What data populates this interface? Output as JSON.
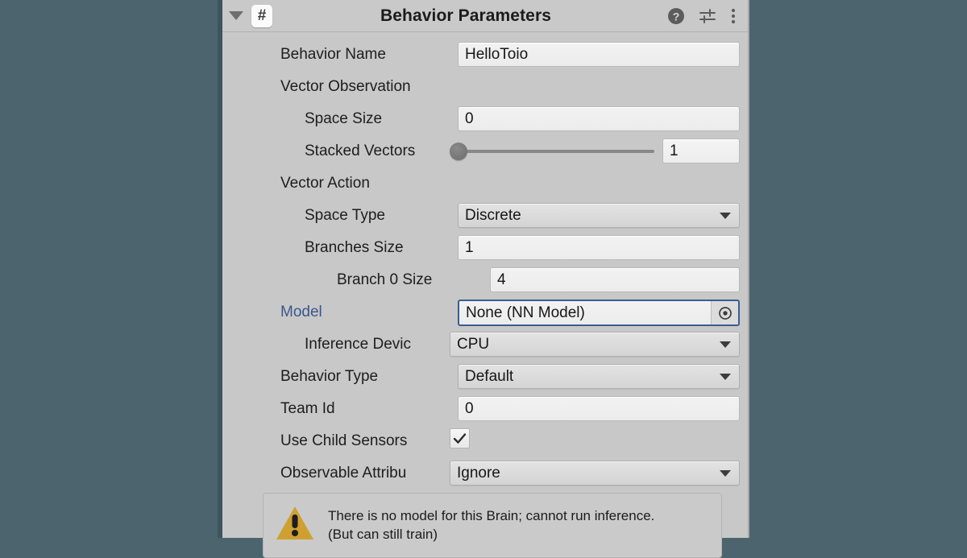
{
  "colors": {
    "editor_background": "#4c646e",
    "panel_background": "#c8c8c8",
    "focus_blue": "#3a5c92",
    "link_blue": "#39568f",
    "warning_amber": "#cfa030"
  },
  "header": {
    "title": "Behavior Parameters",
    "foldout_state": "expanded",
    "script_icon_glyph": "#",
    "icons": [
      {
        "name": "help-icon",
        "glyph": "?"
      },
      {
        "name": "preset-icon",
        "glyph": "sliders"
      },
      {
        "name": "more-menu-icon",
        "glyph": "⋮"
      }
    ]
  },
  "fields": {
    "behavior_name": {
      "label": "Behavior Name",
      "value": "HelloToio"
    },
    "vector_observation": {
      "label": "Vector Observation"
    },
    "space_size": {
      "label": "Space Size",
      "value": "0"
    },
    "stacked_vectors": {
      "label": "Stacked Vectors",
      "value": "1",
      "slider_position_pct": 0
    },
    "vector_action": {
      "label": "Vector Action"
    },
    "space_type": {
      "label": "Space Type",
      "value": "Discrete"
    },
    "branches_size": {
      "label": "Branches Size",
      "value": "1"
    },
    "branch_0_size": {
      "label": "Branch 0 Size",
      "value": "4"
    },
    "model": {
      "label": "Model",
      "value": "None (NN Model)"
    },
    "inference_device": {
      "label": "Inference Devic",
      "value": "CPU"
    },
    "behavior_type": {
      "label": "Behavior Type",
      "value": "Default"
    },
    "team_id": {
      "label": "Team Id",
      "value": "0"
    },
    "use_child_sensors": {
      "label": "Use Child Sensors",
      "checked": true
    },
    "observable_attributes": {
      "label": "Observable Attribu",
      "value": "Ignore"
    }
  },
  "warning": {
    "line1": "There is no model for this Brain; cannot run inference.",
    "line2": "(But can still train)"
  }
}
